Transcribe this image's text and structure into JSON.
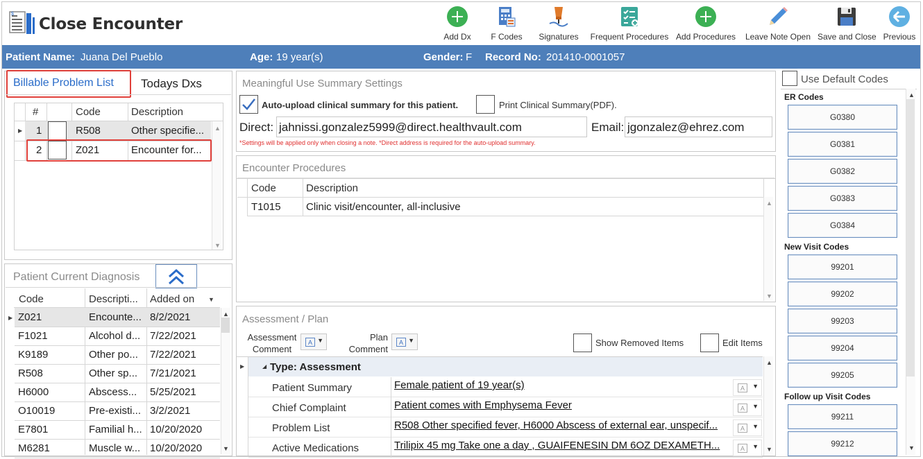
{
  "window": {
    "title": "Close Encounter"
  },
  "toolbar": [
    {
      "label": "Add Dx",
      "icon": "plus-circle-icon"
    },
    {
      "label": "F Codes",
      "icon": "calculator-icon"
    },
    {
      "label": "Signatures",
      "icon": "pen-signature-icon"
    },
    {
      "label": "Frequent Procedures",
      "icon": "checklist-icon"
    },
    {
      "label": "Add Procedures",
      "icon": "plus-circle-icon"
    },
    {
      "label": "Leave Note Open",
      "icon": "pencil-icon"
    },
    {
      "label": "Save and Close",
      "icon": "floppy-disk-icon"
    },
    {
      "label": "Previous",
      "icon": "back-arrow-icon"
    }
  ],
  "patient": {
    "name_label": "Patient Name:",
    "name": "Juana Del Pueblo",
    "age_label": "Age:",
    "age": "19 year(s)",
    "gender_label": "Gender:",
    "gender": "F",
    "record_label": "Record No:",
    "record": "201410-0001057"
  },
  "problem_tabs": {
    "billable": "Billable Problem List",
    "todays": "Todays Dxs"
  },
  "problem_grid": {
    "columns": [
      "#",
      "",
      "Code",
      "Description"
    ],
    "rows": [
      {
        "num": "1",
        "code": "R508",
        "desc": "Other specifie..."
      },
      {
        "num": "2",
        "code": "Z021",
        "desc": "Encounter for..."
      }
    ]
  },
  "current_dx": {
    "title": "Patient Current Diagnosis",
    "columns": [
      "Code",
      "Descripti...",
      "Added on"
    ],
    "rows": [
      {
        "code": "Z021",
        "desc": "Encounte...",
        "date": "8/2/2021"
      },
      {
        "code": "F1021",
        "desc": "Alcohol d...",
        "date": "7/22/2021"
      },
      {
        "code": "K9189",
        "desc": "Other po...",
        "date": "7/22/2021"
      },
      {
        "code": "R508",
        "desc": "Other sp...",
        "date": "7/21/2021"
      },
      {
        "code": "H6000",
        "desc": "Abscess...",
        "date": "5/25/2021"
      },
      {
        "code": "O10019",
        "desc": "Pre-existi...",
        "date": "3/2/2021"
      },
      {
        "code": "E7801",
        "desc": "Familial h...",
        "date": "10/20/2020"
      },
      {
        "code": "M6281",
        "desc": "Muscle w...",
        "date": "10/20/2020"
      }
    ]
  },
  "mu": {
    "title": "Meaningful Use Summary Settings",
    "auto_upload": "Auto-upload clinical summary for this patient.",
    "auto_upload_checked": true,
    "print_summary": "Print Clinical Summary(PDF).",
    "direct_label": "Direct:",
    "direct_value": "jahnissi.gonzalez5999@direct.healthvault.com",
    "email_label": "Email:",
    "email_value": "jgonzalez@ehrez.com",
    "note": "*Settings will be applied only when closing a note.   *Direct address is required for the auto-upload summary."
  },
  "procedures": {
    "title": "Encounter Procedures",
    "columns": [
      "Code",
      "Description"
    ],
    "rows": [
      {
        "code": "T1015",
        "desc": "Clinic visit/encounter, all-inclusive"
      }
    ]
  },
  "assessment": {
    "title": "Assessment / Plan",
    "assessment_comment": "Assessment Comment",
    "assessment_comment_l1": "Assessment",
    "assessment_comment_l2": "Comment",
    "plan_comment_l1": "Plan",
    "plan_comment_l2": "Comment",
    "show_removed": "Show Removed Items",
    "edit_items": "Edit Items",
    "group": "Type: Assessment",
    "rows": [
      {
        "label": "Patient Summary",
        "value": "Female patient of 19 year(s)"
      },
      {
        "label": "Chief Complaint",
        "value": "Patient comes with  Emphysema  Fever "
      },
      {
        "label": "Problem List",
        "value": "R508 Other specified fever, H6000 Abscess of external ear, unspecif..."
      },
      {
        "label": "Active Medications",
        "value": "Trilipix 45 mg Take one a day , GUAIFENESIN DM 6OZ  DEXAMETH..."
      }
    ]
  },
  "codes": {
    "use_default": "Use Default Codes",
    "er_title": "ER Codes",
    "er": [
      "G0380",
      "G0381",
      "G0382",
      "G0383",
      "G0384"
    ],
    "new_title": "New Visit Codes",
    "new": [
      "99201",
      "99202",
      "99203",
      "99204",
      "99205"
    ],
    "followup_title": "Follow up Visit Codes",
    "followup": [
      "99211",
      "99212"
    ]
  },
  "colors": {
    "header_bar": "#4e7fba",
    "accent_blue": "#2a6cc9",
    "highlight_red": "#e0403a",
    "green": "#3cb054"
  }
}
